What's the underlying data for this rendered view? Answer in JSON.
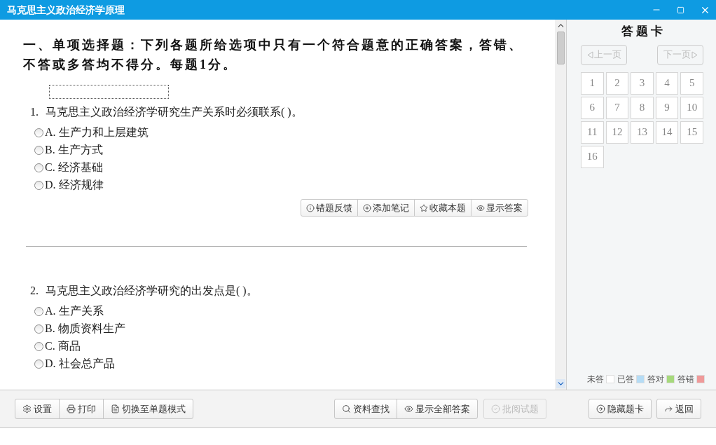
{
  "window": {
    "title": "马克思主义政治经济学原理"
  },
  "section_heading": "一、单项选择题：下列各题所给选项中只有一个符合题意的正确答案，答错、不答或多答均不得分。每题1分。",
  "questions": [
    {
      "number": "1.",
      "text": "马克思主义政治经济学研究生产关系时必须联系(   )。",
      "focused": true,
      "options": [
        {
          "letter": "A.",
          "text": "生产力和上层建筑",
          "selected": false
        },
        {
          "letter": "B.",
          "text": "生产方式",
          "selected": false
        },
        {
          "letter": "C.",
          "text": "经济基础",
          "selected": false
        },
        {
          "letter": "D.",
          "text": "经济规律",
          "selected": false
        }
      ],
      "actions": [
        {
          "kind": "feedback",
          "label": "错题反馈"
        },
        {
          "kind": "note",
          "label": "添加笔记"
        },
        {
          "kind": "favorite",
          "label": "收藏本题"
        },
        {
          "kind": "answer",
          "label": "显示答案"
        }
      ]
    },
    {
      "number": "2.",
      "text": "马克思主义政治经济学研究的出发点是(   )。",
      "options": [
        {
          "letter": "A.",
          "text": "生产关系",
          "selected": false
        },
        {
          "letter": "B.",
          "text": "物质资料生产",
          "selected": false
        },
        {
          "letter": "C.",
          "text": "商品",
          "selected": false
        },
        {
          "letter": "D.",
          "text": "社会总产品",
          "selected": false
        }
      ]
    }
  ],
  "answer_card": {
    "title": "答 题 卡",
    "prev": {
      "label": "上一页",
      "disabled": true
    },
    "next": {
      "label": "下一页",
      "disabled": true
    },
    "items": [
      {
        "label": "1"
      },
      {
        "label": "2"
      },
      {
        "label": "3"
      },
      {
        "label": "4"
      },
      {
        "label": "5"
      },
      {
        "label": "6"
      },
      {
        "label": "7"
      },
      {
        "label": "8"
      },
      {
        "label": "9"
      },
      {
        "label": "10"
      },
      {
        "label": "11"
      },
      {
        "label": "12"
      },
      {
        "label": "13"
      },
      {
        "label": "14"
      },
      {
        "label": "15"
      },
      {
        "label": "16"
      }
    ],
    "legend": [
      {
        "label": "未答",
        "color": "#ffffff"
      },
      {
        "label": "已答",
        "color": "#b5dcf5"
      },
      {
        "label": "答对",
        "color": "#a6d97c"
      },
      {
        "label": "答错",
        "color": "#ef9a9a"
      }
    ]
  },
  "toolbar": {
    "left": [
      {
        "kind": "settings",
        "label": "设置",
        "disabled": false
      },
      {
        "kind": "print",
        "label": "打印",
        "disabled": false
      },
      {
        "kind": "mode",
        "label": "切换至单题模式",
        "disabled": false
      }
    ],
    "middle": [
      {
        "kind": "search",
        "label": "资料查找",
        "disabled": false
      },
      {
        "kind": "answers",
        "label": "显示全部答案",
        "disabled": false
      }
    ],
    "grade": {
      "kind": "grade",
      "label": "批阅试题",
      "disabled": true
    },
    "right": [
      {
        "kind": "hide",
        "label": "隐藏题卡",
        "disabled": false
      },
      {
        "kind": "back",
        "label": "返回",
        "disabled": false
      }
    ]
  }
}
